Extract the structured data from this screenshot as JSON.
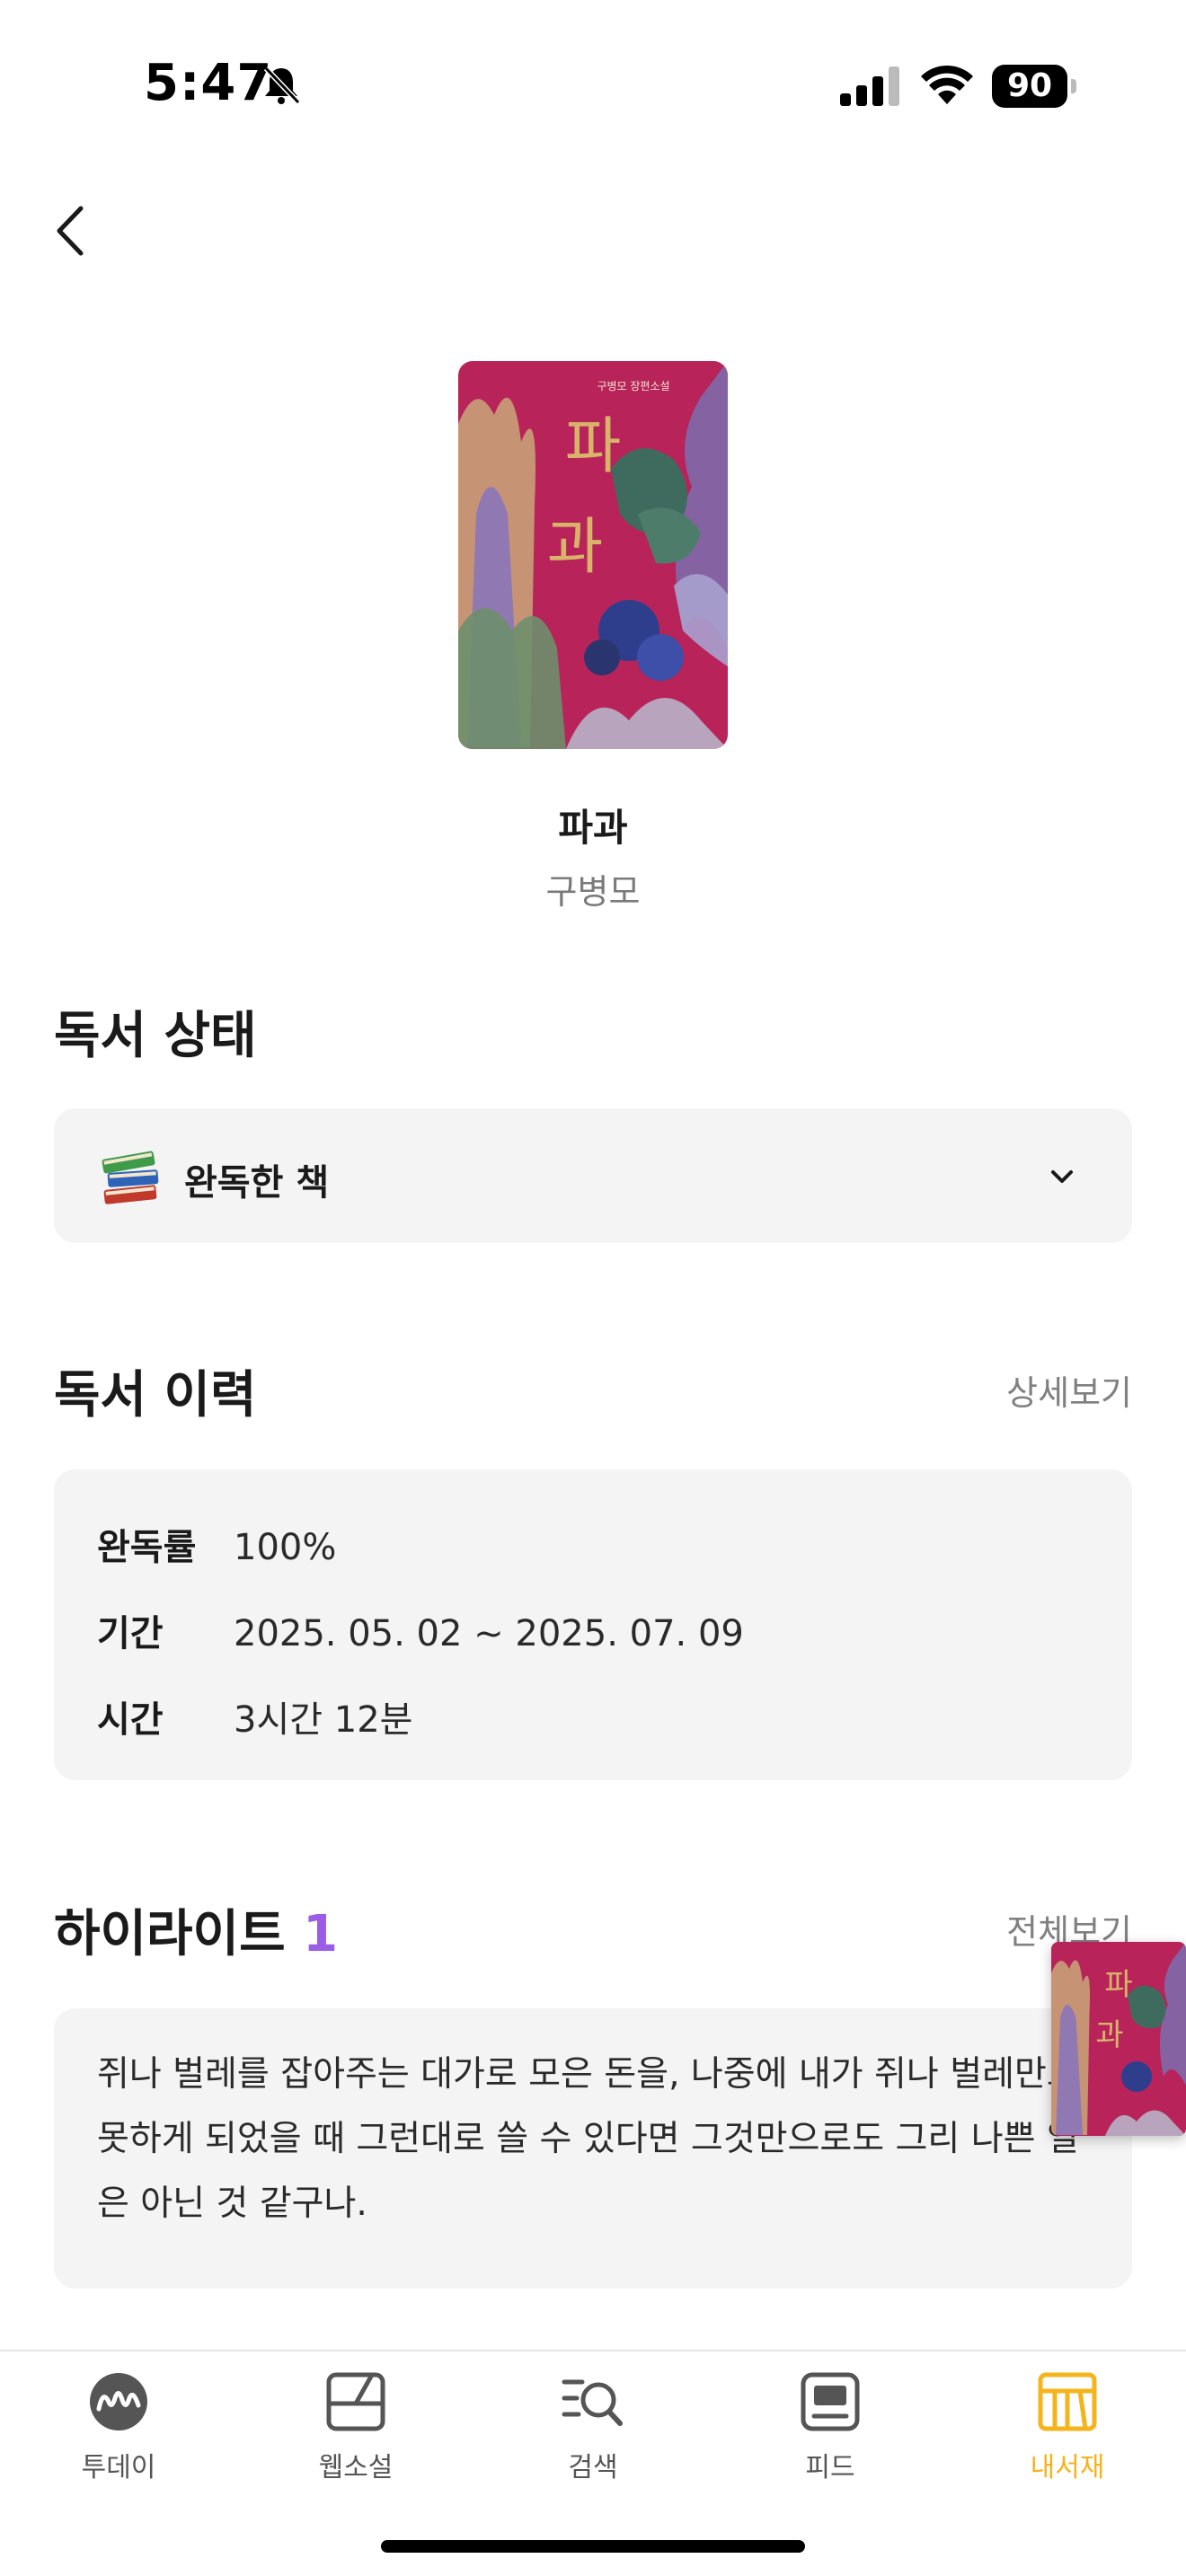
{
  "status_bar": {
    "time": "5:47",
    "battery": "90"
  },
  "book": {
    "title": "파과",
    "author": "구병모",
    "cover_title": "파과",
    "cover_subtitle": "구병모 장편소설"
  },
  "reading_status": {
    "section_title": "독서 상태",
    "selected": "완독한 책"
  },
  "reading_history": {
    "section_title": "독서 이력",
    "detail_link": "상세보기",
    "rows": [
      {
        "key": "완독률",
        "value": "100%"
      },
      {
        "key": "기간",
        "value": "2025. 05. 02 ~ 2025. 07. 09"
      },
      {
        "key": "시간",
        "value": "3시간 12분"
      }
    ]
  },
  "highlights": {
    "section_title": "하이라이트",
    "count": "1",
    "view_all_link": "전체보기",
    "items": [
      {
        "text": "쥐나 벌레를 잡아주는 대가로 모은 돈을, 나중에 내가 쥐나 벌레만도 못하게 되었을 때 그런대로 쓸 수 있다면 그것만으로도 그리 나쁜 일은 아닌 것 같구나."
      }
    ]
  },
  "tab_bar": {
    "tabs": [
      {
        "label": "투데이",
        "icon": "today-icon",
        "active": false
      },
      {
        "label": "웹소설",
        "icon": "web-novel-icon",
        "active": false
      },
      {
        "label": "검색",
        "icon": "search-icon",
        "active": false
      },
      {
        "label": "피드",
        "icon": "feed-icon",
        "active": false
      },
      {
        "label": "내서재",
        "icon": "library-icon",
        "active": true
      }
    ]
  },
  "colors": {
    "accent_highlight": "#9b5de5",
    "active_tab": "#f5b31c",
    "cover_bg": "#b8235a"
  }
}
